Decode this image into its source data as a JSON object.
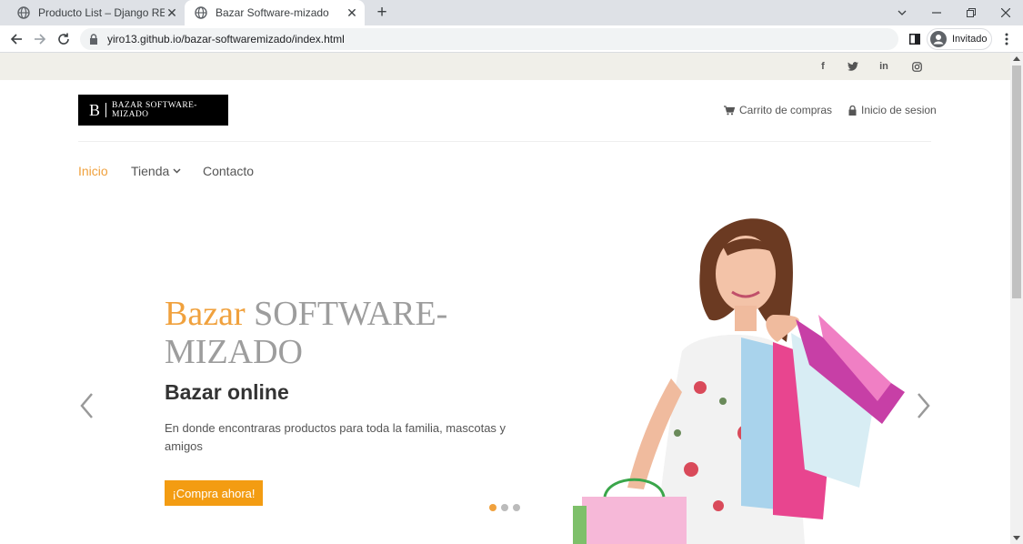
{
  "browser": {
    "tabs": [
      {
        "title": "Producto List – Django REST fram",
        "favicon": "globe-icon"
      },
      {
        "title": "Bazar Software-mizado",
        "favicon": "globe-icon"
      }
    ],
    "url": "yiro13.github.io/bazar-softwaremizado/index.html",
    "profile_label": "Invitado"
  },
  "site": {
    "logo": {
      "mark": "B",
      "text": "BAZAR SOFTWARE-MIZADO"
    },
    "social": [
      "facebook-icon",
      "twitter-icon",
      "linkedin-icon",
      "instagram-icon"
    ],
    "header_links": {
      "cart": "Carrito de compras",
      "login": "Inicio de sesion"
    },
    "nav": {
      "home": "Inicio",
      "shop": "Tienda",
      "contact": "Contacto"
    },
    "hero": {
      "title_accent": "Bazar",
      "title_rest": "SOFTWARE-MIZADO",
      "subtitle": "Bazar online",
      "description": "En donde encontraras productos para toda la familia, mascotas y amigos",
      "cta": "¡Compra ahora!",
      "slide_count": 3,
      "active_slide": 1
    },
    "colors": {
      "accent": "#f0a13d",
      "button": "#f39c12",
      "topbar": "#f0efe9"
    }
  }
}
